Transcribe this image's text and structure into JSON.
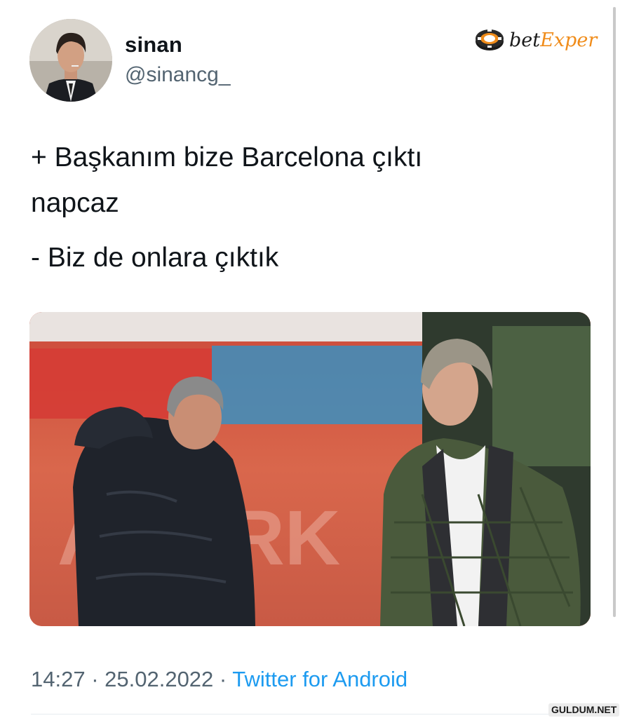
{
  "profile": {
    "display_name": "sinan",
    "handle": "@sinancg_",
    "avatar_icon": "profile-photo-man-in-suit"
  },
  "brand": {
    "part1": "bet",
    "part2": "Exper",
    "icon": "poker-chip-icon",
    "accent_color": "#f08c1a"
  },
  "tweet": {
    "lines": [
      "+ Başkanım bize Barcelona çıktı",
      "napcaz",
      "- Biz de onlara çıktık"
    ]
  },
  "media": {
    "icon": "photo-two-men-talking-on-football-pitch"
  },
  "meta": {
    "time": "14:27",
    "separator1": " · ",
    "date": "25.02.2022",
    "separator2": " · ",
    "source": "Twitter for Android",
    "link_color": "#1d9bf0"
  },
  "watermark": {
    "text": "GULDUM.NET"
  }
}
